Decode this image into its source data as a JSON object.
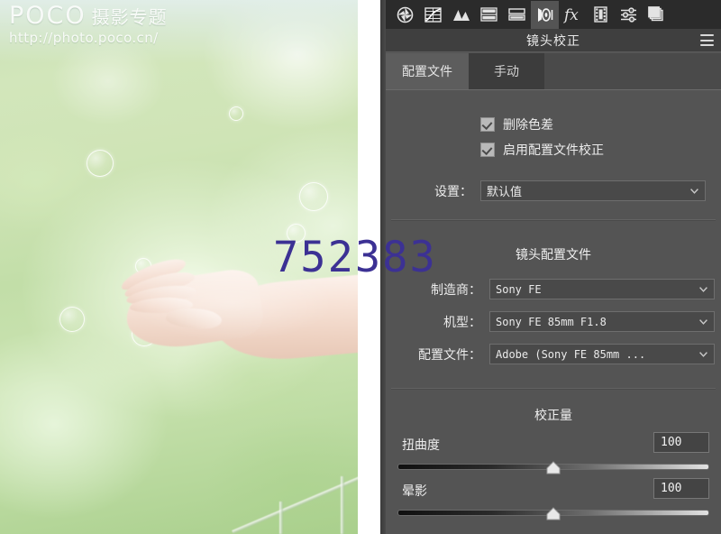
{
  "photo": {
    "watermark": {
      "brand": "POCO",
      "subtitle": "摄影专题",
      "url": "http://photo.poco.cn/"
    },
    "overlay_number": "752383",
    "overlay_color": "#3c3194",
    "subject_description": "open palm with soap bubbles on green bokeh background"
  },
  "panel": {
    "title": "镜头校正",
    "menu_icon": "hamburger-icon",
    "icon_bar": [
      {
        "name": "basic-icon",
        "label": "基本",
        "active": false
      },
      {
        "name": "tone-curve-icon",
        "label": "色调曲线",
        "active": false
      },
      {
        "name": "detail-icon",
        "label": "细节",
        "active": false
      },
      {
        "name": "hsl-grayscale-icon",
        "label": "HSL/灰度",
        "active": false
      },
      {
        "name": "split-toning-icon",
        "label": "分离色调",
        "active": false
      },
      {
        "name": "lens-correction-icon",
        "label": "镜头校正",
        "active": true
      },
      {
        "name": "effects-icon",
        "label": "效果",
        "active": false
      },
      {
        "name": "camera-calibration-icon",
        "label": "相机校准",
        "active": false
      },
      {
        "name": "presets-icon",
        "label": "预设",
        "active": false
      },
      {
        "name": "snapshots-icon",
        "label": "快照",
        "active": false
      }
    ],
    "tabs": [
      {
        "label": "配置文件",
        "active": true
      },
      {
        "label": "手动",
        "active": false
      }
    ],
    "checkboxes": [
      {
        "label": "删除色差",
        "checked": true
      },
      {
        "label": "启用配置文件校正",
        "checked": true
      }
    ],
    "settings_row": {
      "label": "设置：",
      "value": "默认值"
    },
    "lens_profile": {
      "section_title": "镜头配置文件",
      "rows": [
        {
          "label": "制造商：",
          "value": "Sony FE"
        },
        {
          "label": "机型：",
          "value": "Sony FE 85mm F1.8"
        },
        {
          "label": "配置文件：",
          "value": "Adobe (Sony FE 85mm ..."
        }
      ]
    },
    "correction_amount": {
      "section_title": "校正量",
      "sliders": [
        {
          "label": "扭曲度",
          "value": "100",
          "position_pct": 50
        },
        {
          "label": "晕影",
          "value": "100",
          "position_pct": 50
        }
      ]
    }
  },
  "colors": {
    "panel_bg": "#545454",
    "icon_bar_bg": "#2b2b2b",
    "title_bar_bg": "#3f3f3f",
    "tab_active_bg": "#5d5d5d",
    "tab_inactive_bg": "#3c3c3c",
    "field_bg": "#494949",
    "accent_number": "#3c3194"
  }
}
